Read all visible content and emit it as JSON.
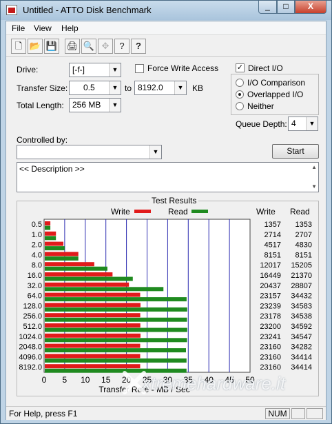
{
  "window": {
    "title": "Untitled - ATTO Disk Benchmark",
    "close_glyph": "X",
    "min_glyph": "_",
    "max_glyph": "□"
  },
  "menu": [
    {
      "label": "File"
    },
    {
      "label": "View"
    },
    {
      "label": "Help"
    }
  ],
  "toolbar": [
    {
      "icon": "new-document-icon",
      "glyph": "🗋",
      "enabled": true
    },
    {
      "icon": "open-folder-icon",
      "glyph": "📂",
      "enabled": true
    },
    {
      "icon": "save-icon",
      "glyph": "💾",
      "enabled": true
    },
    {
      "icon": "print-icon",
      "glyph": "🖨",
      "enabled": true
    },
    {
      "icon": "print-preview-icon",
      "glyph": "🔍",
      "enabled": true
    },
    {
      "icon": "move-icon",
      "glyph": "✥",
      "enabled": false
    },
    {
      "icon": "help-icon",
      "glyph": "?",
      "enabled": true
    },
    {
      "icon": "context-help-icon",
      "glyph": "?",
      "enabled": true
    }
  ],
  "form": {
    "drive_label": "Drive:",
    "drive_value": "[-f-]",
    "force_write_label": "Force Write Access",
    "force_write_checked": false,
    "direct_io_label": "Direct I/O",
    "direct_io_checked": true,
    "transfer_size_label": "Transfer Size:",
    "transfer_from": "0.5",
    "to_label": "to",
    "transfer_to": "8192.0",
    "kb_label": "KB",
    "total_length_label": "Total Length:",
    "total_length_value": "256 MB",
    "io_options": [
      {
        "label": "I/O Comparison",
        "selected": false
      },
      {
        "label": "Overlapped I/O",
        "selected": true
      },
      {
        "label": "Neither",
        "selected": false
      }
    ],
    "queue_depth_label": "Queue Depth:",
    "queue_depth_value": "4",
    "controlled_by_label": "Controlled by:",
    "controlled_by_value": "",
    "start_label": "Start",
    "description": "<< Description >>"
  },
  "results_title": "Test Results",
  "chart_data": {
    "type": "bar",
    "categories": [
      "0.5",
      "1.0",
      "2.0",
      "4.0",
      "8.0",
      "16.0",
      "32.0",
      "64.0",
      "128.0",
      "256.0",
      "512.0",
      "1024.0",
      "2048.0",
      "4096.0",
      "8192.0"
    ],
    "series": [
      {
        "name": "Write",
        "color": "#e11b1b",
        "values": [
          1357,
          2714,
          4517,
          8151,
          12017,
          16449,
          20437,
          23157,
          23239,
          23178,
          23200,
          23241,
          23160,
          23160,
          23160
        ]
      },
      {
        "name": "Read",
        "color": "#1f8a1f",
        "values": [
          1353,
          2707,
          4830,
          8151,
          15205,
          21370,
          28807,
          34432,
          34583,
          34538,
          34592,
          34547,
          34282,
          34414,
          34414
        ]
      }
    ],
    "xlabel": "Transfer Rate - MB / Sec",
    "xticks": [
      "0",
      "5",
      "10",
      "15",
      "20",
      "25",
      "30",
      "35",
      "40",
      "45",
      "50"
    ],
    "xlim": [
      0,
      50
    ],
    "table_headers": [
      "Write",
      "Read"
    ],
    "grid": true
  },
  "status": {
    "text": "For Help, press F1",
    "num": "NUM"
  },
  "watermark": "xtremehardware.it"
}
